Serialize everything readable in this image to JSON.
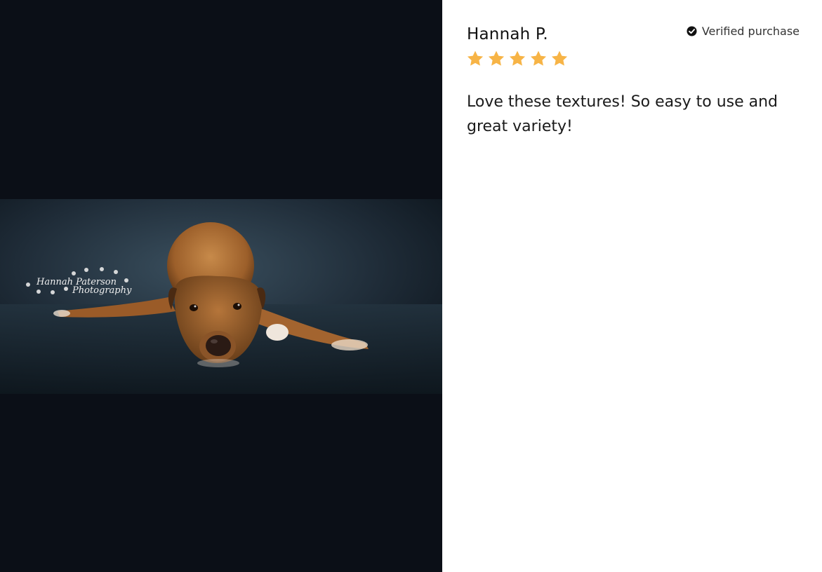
{
  "review": {
    "reviewer_name": "Hannah P.",
    "verified_label": "Verified purchase",
    "rating": 5,
    "rating_max": 5,
    "body": "Love these textures! So easy to use and great variety!"
  },
  "photo": {
    "watermark_line1": "Hannah Paterson",
    "watermark_line2": "Photography",
    "subject": "dog-lying-on-textured-backdrop"
  },
  "colors": {
    "media_background": "#0b0f17",
    "star": "#f7b446",
    "text": "#1a1a1a",
    "check_icon": "#111111"
  },
  "icons": [
    "check-circle-icon",
    "star-icon"
  ]
}
